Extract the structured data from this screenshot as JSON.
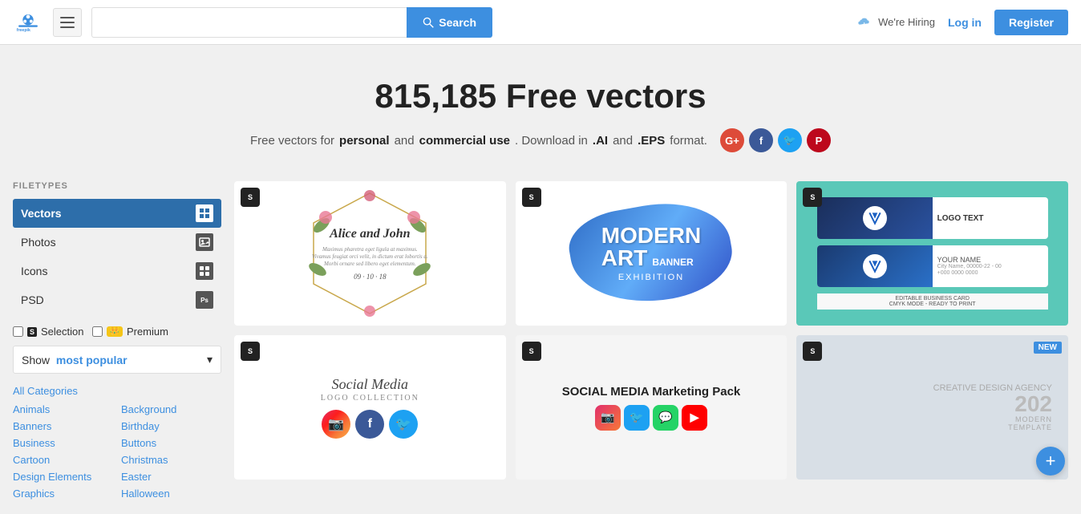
{
  "header": {
    "logo_alt": "Freepik",
    "search_placeholder": "",
    "search_label": "Search",
    "hamburger_label": "Menu",
    "hiring_text": "We're Hiring",
    "login_label": "Log in",
    "register_label": "Register"
  },
  "hero": {
    "title": "815,185 Free vectors",
    "subtitle_pre": "Free vectors for",
    "bold1": "personal",
    "mid1": "and",
    "bold2": "commercial use",
    "subtitle_post": ". Download in",
    "bold3": ".AI",
    "mid2": "and",
    "bold4": ".EPS",
    "format": "format."
  },
  "sidebar": {
    "filetypes_label": "FILETYPES",
    "filetypes": [
      {
        "label": "Vectors",
        "active": true,
        "icon": "vectors-icon"
      },
      {
        "label": "Photos",
        "active": false,
        "icon": "photos-icon"
      },
      {
        "label": "Icons",
        "active": false,
        "icon": "icons-icon"
      },
      {
        "label": "PSD",
        "active": false,
        "icon": "psd-icon"
      }
    ],
    "selection_label": "Selection",
    "premium_label": "Premium",
    "show_popular_prefix": "Show",
    "show_popular_highlight": "most popular",
    "all_categories_label": "All Categories",
    "categories_col1": [
      "Animals",
      "Banners",
      "Business",
      "Cartoon",
      "Design Elements",
      "Graphics"
    ],
    "categories_col2": [
      "Background",
      "Birthday",
      "Buttons",
      "Christmas",
      "Easter",
      "Halloween"
    ]
  },
  "cards": [
    {
      "id": "card1",
      "type": "floral",
      "badge": "S",
      "alt": "Floral wedding invitation"
    },
    {
      "id": "card2",
      "type": "art",
      "badge": "S",
      "title_line1": "MODERN",
      "title_line2": "ART",
      "subtitle": "BANNER",
      "sub2": "EXHIBITION",
      "alt": "Modern art banner"
    },
    {
      "id": "card3",
      "type": "business",
      "badge": "S",
      "logo_text": "LOGO TEXT",
      "your_name": "YOUR NAME",
      "alt": "Business card template"
    },
    {
      "id": "card4",
      "type": "social",
      "badge": "S",
      "title": "Social Media",
      "subtitle": "LOGO COLLECTION",
      "alt": "Social media logo collection"
    },
    {
      "id": "card5",
      "type": "social2",
      "badge": "S",
      "title": "SOCIAL MEDIA Marketing Pack",
      "alt": "Social Media Marketing Pack"
    },
    {
      "id": "card6",
      "type": "design",
      "badge": "S",
      "new_badge": "NEW",
      "alt": "Creative design template"
    }
  ],
  "fab": {
    "label": "+"
  }
}
